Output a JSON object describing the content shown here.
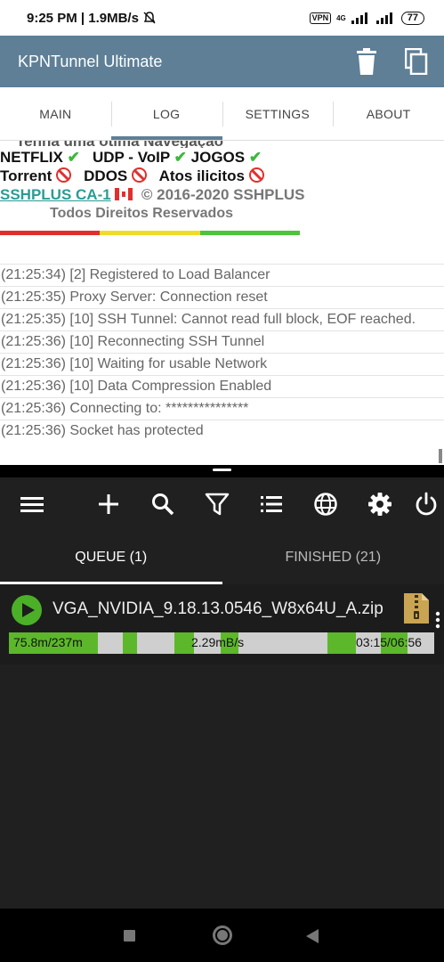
{
  "status_bar": {
    "time_speed": "9:25 PM | 1.9MB/s",
    "vpn": "VPN",
    "network": "4G",
    "battery": "77"
  },
  "app": {
    "title": "KPNTunnel Ultimate",
    "tabs": [
      {
        "label": "MAIN"
      },
      {
        "label": "LOG"
      },
      {
        "label": "SETTINGS"
      },
      {
        "label": "ABOUT"
      }
    ]
  },
  "log": {
    "banner": {
      "cut_line": "Tenha uma ótima Navegação",
      "netflix": "NETFLIX",
      "udp": "UDP - VoIP",
      "jogos": "JOGOS",
      "torrent": "Torrent",
      "ddos": "DDOS",
      "atos": "Atos ilicitos",
      "ssh_link": "SSHPLUS CA-1",
      "copyright": "© 2016-2020 SSHPLUS",
      "rights": "Todos Direitos Reservados"
    },
    "lines": [
      "(21:25:34) [2] Registered to Load Balancer",
      "(21:25:35) Proxy Server: Connection reset",
      "(21:25:35) [10] SSH Tunnel: Cannot read full block, EOF reached.",
      "(21:25:36) [10] Reconnecting SSH Tunnel",
      "(21:25:36) [10] Waiting for usable Network",
      "(21:25:36) [10] Data Compression Enabled",
      "(21:25:36) Connecting to: ***************",
      "(21:25:36) Socket has protected"
    ]
  },
  "downloads": {
    "tabs": [
      {
        "label": "QUEUE (1)"
      },
      {
        "label": "FINISHED (21)"
      }
    ],
    "item": {
      "filename": "VGA_NVIDIA_9.18.13.0546_W8x64U_A.zip",
      "size": "75.8m/237m",
      "speed": "2.29mB/s",
      "time": "03:15/06:56"
    }
  },
  "colors": {
    "app_bar": "#5e7f96",
    "progress_green": "#5cb82a",
    "dm_bg": "#202020"
  }
}
